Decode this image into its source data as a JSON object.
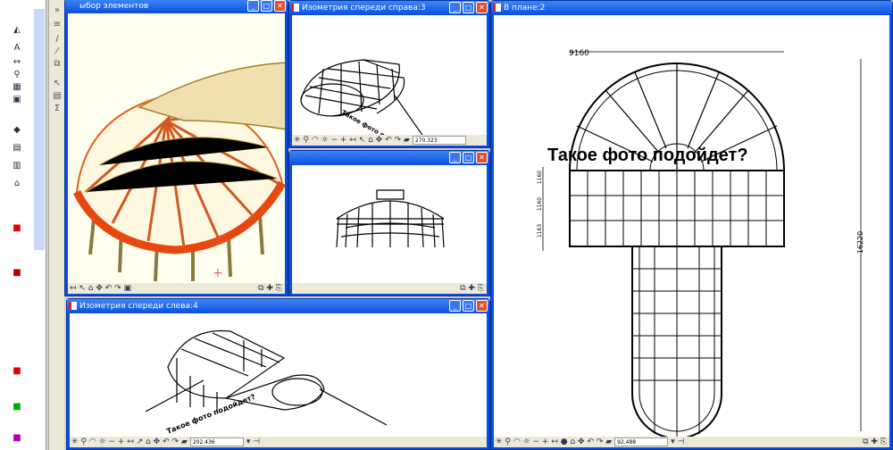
{
  "windows": {
    "view3d": {
      "title": "ыбор элементов"
    },
    "iso_right": {
      "title": "Изометрия спереди справа:3",
      "scale": "270.323"
    },
    "front": {
      "title": ""
    },
    "iso_left": {
      "title": "Изометрия спереди слева:4",
      "scale": "202.436"
    },
    "plan": {
      "title": "В плане:2",
      "scale": "92.488"
    }
  },
  "plan_dimensions": {
    "width": "9160",
    "length": "16220",
    "segments": [
      "1160",
      "1160",
      "1163"
    ]
  },
  "overlay_text": "Такое фото подойдет?",
  "rotated_label": "Такое фото подойдет?",
  "toolbar_icons": [
    "asterisk-icon",
    "zoom-icon",
    "orbit-icon",
    "sun-icon",
    "minus-icon",
    "plus-icon",
    "arrow-icon",
    "select-icon",
    "camera-icon",
    "pan-icon",
    "undo-icon",
    "redo-icon",
    "folder-icon"
  ],
  "colors": {
    "title_bar": "#0a4ee0",
    "close_button": "#e0502e",
    "roof_frame": "#e06020",
    "ring_beam": "#e84810"
  }
}
